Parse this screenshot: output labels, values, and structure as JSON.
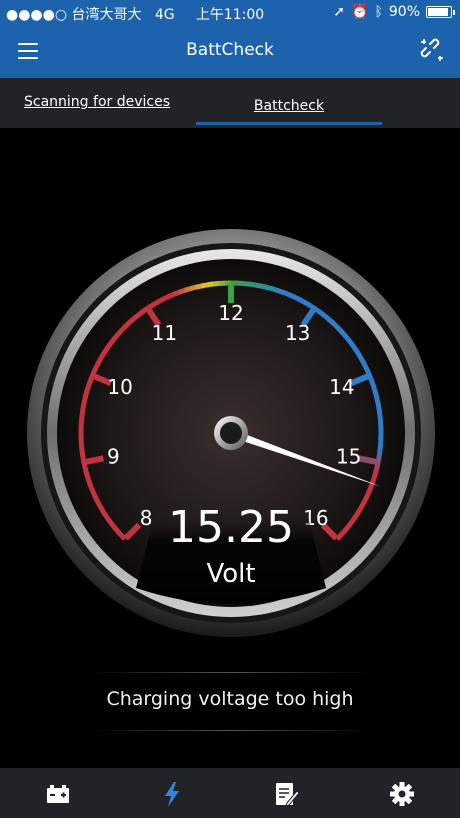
{
  "status_bar": {
    "carrier": "●●●●○ 台湾大哥大",
    "network": "4G",
    "time": "上午11:00",
    "battery_percent": "90%",
    "battery_level": 0.9
  },
  "app_bar": {
    "title": "BattCheck",
    "menu_icon": "hamburger-menu-icon",
    "action_icon": "broken-link-icon"
  },
  "tabs": [
    {
      "label": "Scanning for devices",
      "active": false
    },
    {
      "label": "Battcheck",
      "active": true
    }
  ],
  "gauge": {
    "min": 8,
    "max": 16,
    "ticks": [
      "8",
      "9",
      "10",
      "11",
      "12",
      "13",
      "14",
      "15",
      "16"
    ],
    "value": "15.25",
    "value_numeric": 15.25,
    "unit": "Volt",
    "colors": {
      "low": "#c0333f",
      "ok": "#35a34a",
      "high": "#2f7cc4",
      "needle": "#ffffff"
    }
  },
  "status_message": "Charging voltage too high",
  "bottom_nav": [
    {
      "icon": "battery-icon",
      "active": false
    },
    {
      "icon": "lightning-icon",
      "active": true
    },
    {
      "icon": "notes-edit-icon",
      "active": false
    },
    {
      "icon": "settings-gear-icon",
      "active": false
    }
  ],
  "colors": {
    "primary": "#1c62ad",
    "nav_bg": "#222326",
    "active_icon": "#2f86e0"
  }
}
